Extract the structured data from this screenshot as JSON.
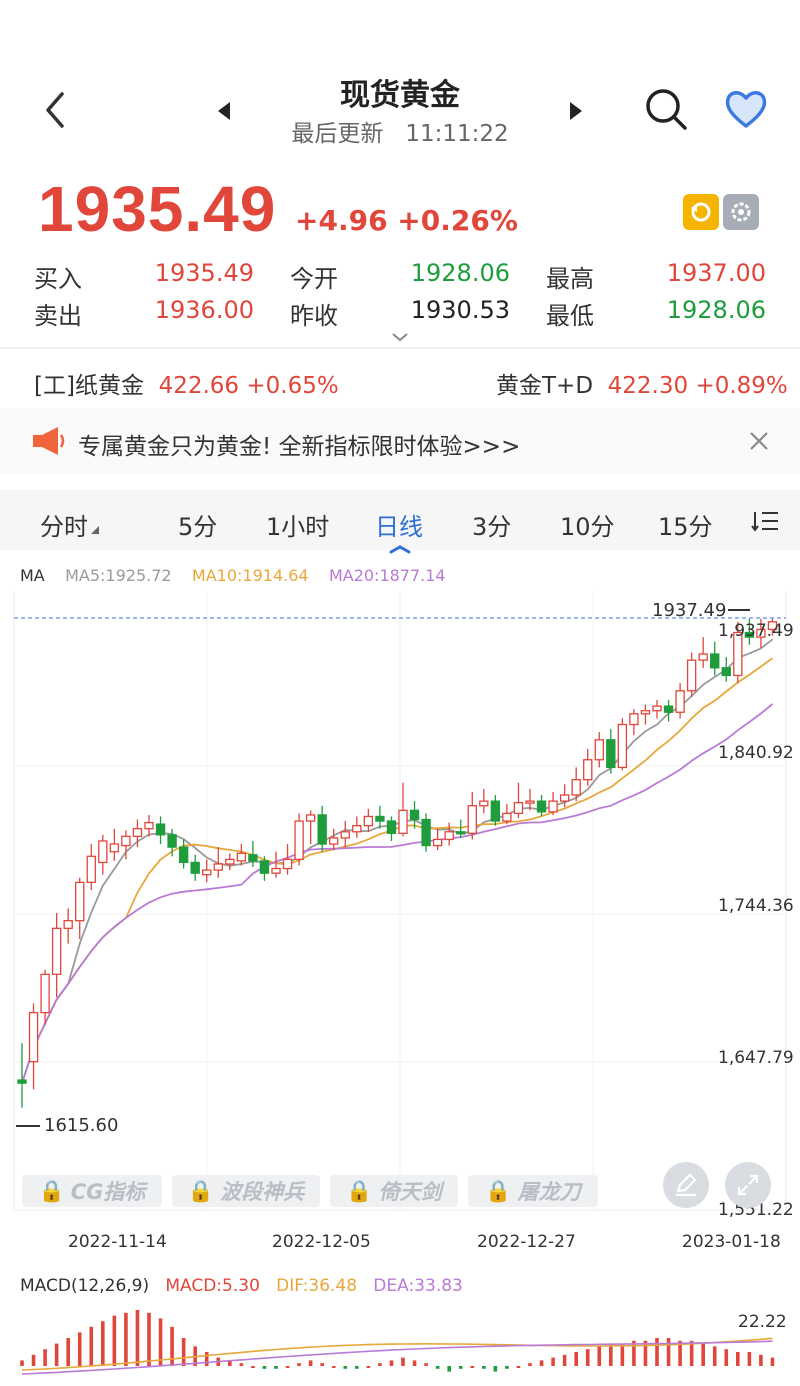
{
  "header": {
    "title": "现货黄金",
    "updated_label": "最后更新",
    "updated_time": "11:11:22"
  },
  "quote": {
    "price": "1935.49",
    "change": "+4.96",
    "change_pct": "+0.26%",
    "buy_label": "买入",
    "buy": "1935.49",
    "sell_label": "卖出",
    "sell": "1936.00",
    "open_label": "今开",
    "open": "1928.06",
    "prev_label": "昨收",
    "prev": "1930.53",
    "high_label": "最高",
    "high": "1937.00",
    "low_label": "最低",
    "low": "1928.06"
  },
  "tickers": [
    {
      "name": "[工]纸黄金",
      "value": "422.66 +0.65%"
    },
    {
      "name": "黄金T+D",
      "value": "422.30 +0.89%"
    }
  ],
  "notice": {
    "text": "专属黄金只为黄金! 全新指标限时体验>>>"
  },
  "tabs": [
    "分时",
    "5分",
    "1小时",
    "日线",
    "3分",
    "10分",
    "15分"
  ],
  "active_tab": "日线",
  "ma_legend": {
    "label": "MA",
    "ma5": "MA5:1925.72",
    "ma10": "MA10:1914.64",
    "ma20": "MA20:1877.14"
  },
  "price_axis": [
    "1,937.49",
    "1,840.92",
    "1,744.36",
    "1,647.79",
    "1,551.22"
  ],
  "markers": {
    "high": "1937.49",
    "low": "1615.60"
  },
  "dates": [
    "2022-11-14",
    "2022-12-05",
    "2022-12-27",
    "2023-01-18"
  ],
  "indicator_buttons": [
    "CG指标",
    "波段神兵",
    "倚天剑",
    "屠龙刀"
  ],
  "macd_legend": {
    "label": "MACD(12,26,9)",
    "macd": "MACD:5.30",
    "dif": "DIF:36.48",
    "dea": "DEA:33.83"
  },
  "macd_axis": "22.22",
  "colors": {
    "up": "#e0463a",
    "down": "#1f9d3c",
    "accent": "#2f6fd3",
    "ma5": "#9a9a9a",
    "ma10": "#e8a73a",
    "ma20": "#b97ad6"
  },
  "chart_data": {
    "type": "candlestick",
    "ylim": [
      1551.22,
      1937.49
    ],
    "candles": [
      [
        1636,
        1634,
        1660,
        1618
      ],
      [
        1648,
        1680,
        1686,
        1630
      ],
      [
        1680,
        1705,
        1708,
        1672
      ],
      [
        1705,
        1735,
        1745,
        1690
      ],
      [
        1735,
        1740,
        1748,
        1725
      ],
      [
        1740,
        1765,
        1768,
        1728
      ],
      [
        1765,
        1782,
        1790,
        1760
      ],
      [
        1778,
        1792,
        1796,
        1770
      ],
      [
        1785,
        1790,
        1800,
        1779
      ],
      [
        1789,
        1795,
        1799,
        1780
      ],
      [
        1795,
        1800,
        1806,
        1788
      ],
      [
        1800,
        1804,
        1809,
        1795
      ],
      [
        1803,
        1796,
        1808,
        1790
      ],
      [
        1796,
        1788,
        1800,
        1782
      ],
      [
        1788,
        1778,
        1793,
        1774
      ],
      [
        1778,
        1771,
        1783,
        1766
      ],
      [
        1770,
        1773,
        1780,
        1765
      ],
      [
        1773,
        1777,
        1788,
        1768
      ],
      [
        1777,
        1780,
        1784,
        1773
      ],
      [
        1779,
        1784,
        1790,
        1776
      ],
      [
        1783,
        1779,
        1792,
        1775
      ],
      [
        1779,
        1771,
        1782,
        1766
      ],
      [
        1771,
        1774,
        1785,
        1768
      ],
      [
        1774,
        1780,
        1790,
        1770
      ],
      [
        1780,
        1805,
        1810,
        1776
      ],
      [
        1805,
        1809,
        1812,
        1790
      ],
      [
        1809,
        1790,
        1815,
        1785
      ],
      [
        1790,
        1794,
        1800,
        1786
      ],
      [
        1794,
        1798,
        1805,
        1788
      ],
      [
        1798,
        1802,
        1808,
        1794
      ],
      [
        1802,
        1808,
        1813,
        1798
      ],
      [
        1808,
        1805,
        1815,
        1800
      ],
      [
        1805,
        1797,
        1808,
        1792
      ],
      [
        1797,
        1812,
        1830,
        1795
      ],
      [
        1812,
        1806,
        1818,
        1800
      ],
      [
        1806,
        1789,
        1810,
        1785
      ],
      [
        1789,
        1793,
        1800,
        1786
      ],
      [
        1793,
        1798,
        1804,
        1789
      ],
      [
        1798,
        1797,
        1806,
        1794
      ],
      [
        1797,
        1815,
        1824,
        1793
      ],
      [
        1815,
        1818,
        1826,
        1810
      ],
      [
        1818,
        1805,
        1822,
        1802
      ],
      [
        1805,
        1810,
        1816,
        1803
      ],
      [
        1810,
        1817,
        1830,
        1807
      ],
      [
        1817,
        1818,
        1826,
        1812
      ],
      [
        1818,
        1811,
        1822,
        1808
      ],
      [
        1811,
        1818,
        1824,
        1809
      ],
      [
        1818,
        1822,
        1829,
        1814
      ],
      [
        1822,
        1832,
        1840,
        1818
      ],
      [
        1832,
        1845,
        1852,
        1828
      ],
      [
        1845,
        1858,
        1863,
        1840
      ],
      [
        1858,
        1840,
        1865,
        1836
      ],
      [
        1840,
        1868,
        1872,
        1838
      ],
      [
        1868,
        1875,
        1878,
        1861
      ],
      [
        1875,
        1877,
        1881,
        1868
      ],
      [
        1877,
        1880,
        1884,
        1872
      ],
      [
        1880,
        1876,
        1884,
        1870
      ],
      [
        1876,
        1890,
        1895,
        1872
      ],
      [
        1890,
        1910,
        1915,
        1886
      ],
      [
        1910,
        1914,
        1925,
        1905
      ],
      [
        1914,
        1905,
        1922,
        1900
      ],
      [
        1905,
        1900,
        1912,
        1896
      ],
      [
        1900,
        1928,
        1935,
        1895
      ],
      [
        1928,
        1925,
        1937,
        1920
      ],
      [
        1925,
        1930,
        1937,
        1918
      ],
      [
        1930,
        1935,
        1937,
        1926
      ]
    ],
    "macd_hist": [
      2,
      4,
      6,
      8,
      10,
      12,
      14,
      16,
      18,
      19,
      20,
      19,
      17,
      14,
      10,
      7,
      5,
      3,
      2,
      1,
      0,
      -1,
      -1,
      0,
      1,
      2,
      1,
      0,
      -1,
      -1,
      0,
      1,
      2,
      3,
      2,
      1,
      -1,
      -2,
      -1,
      0,
      -1,
      -2,
      -1,
      0,
      1,
      2,
      3,
      4,
      5,
      6,
      7,
      8,
      8,
      9,
      9,
      10,
      10,
      9,
      9,
      8,
      7,
      6,
      5,
      5,
      4,
      3
    ]
  }
}
